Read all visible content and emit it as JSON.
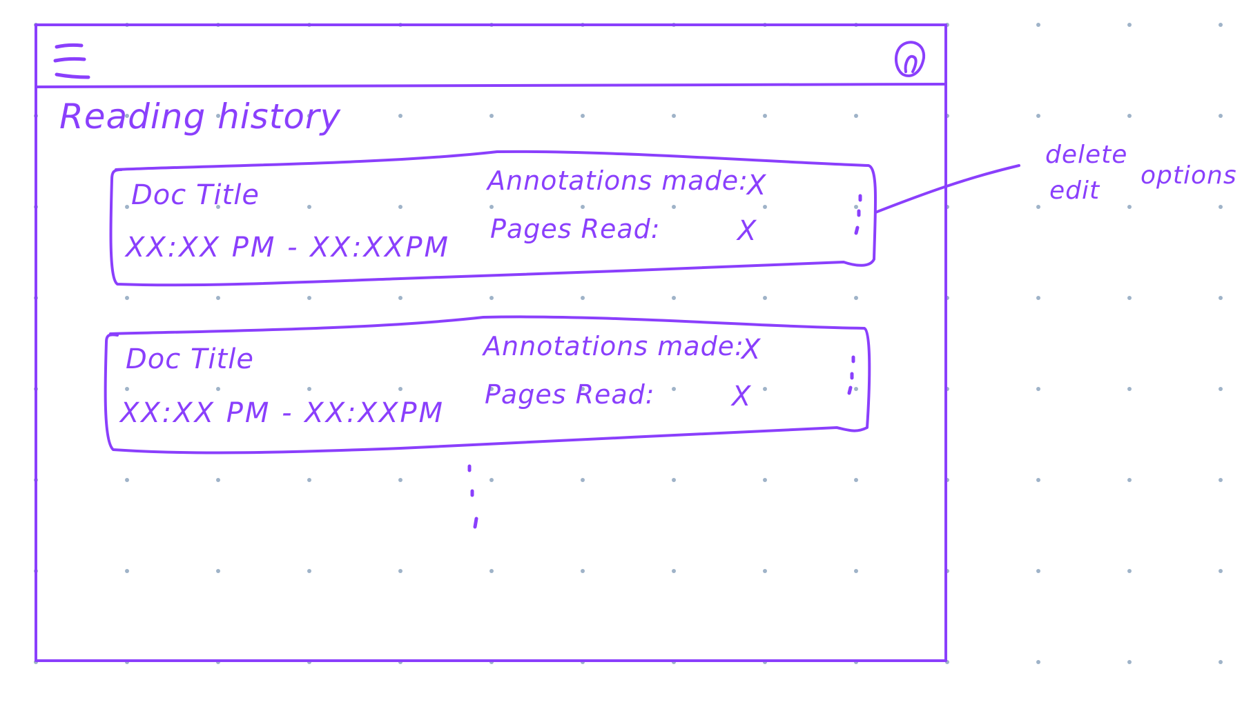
{
  "page": {
    "title": "Reading history"
  },
  "header": {
    "menu_icon": "hamburger-menu-icon",
    "profile_icon": "profile-avatar-icon"
  },
  "entries": [
    {
      "doc_title": "Doc Title",
      "time_range": "XX:XX PM - XX:XXPM",
      "annotations_label": "Annotations made:",
      "annotations_value": "X",
      "pages_label": "Pages Read:",
      "pages_value": "X",
      "more_icon": "kebab-menu-icon"
    },
    {
      "doc_title": "Doc Title",
      "time_range": "XX:XX PM - XX:XXPM",
      "annotations_label": "Annotations made:",
      "annotations_value": "X",
      "pages_label": "Pages Read:",
      "pages_value": "X",
      "more_icon": "kebab-menu-icon"
    }
  ],
  "continuation_marker": "more-entries-ellipsis-icon",
  "annotation_note": {
    "line1": "delete",
    "line2": "edit",
    "suffix": "options"
  },
  "colors": {
    "ink": "#8a3ffc",
    "grid_dot": "#9fb3c8",
    "background": "#ffffff"
  }
}
